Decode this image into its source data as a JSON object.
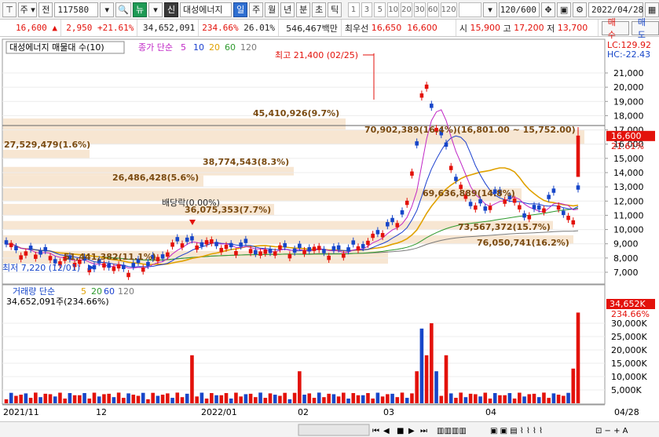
{
  "toolbar": {
    "type_select": "주",
    "prefix": "전",
    "code": "117580",
    "news_btn": "뉴",
    "sin_btn": "신",
    "stock_name": "대성에너지",
    "periods": [
      "일",
      "주",
      "월",
      "년",
      "분",
      "초",
      "틱"
    ],
    "active_period": "일",
    "minute_steps": [
      "1",
      "3",
      "5",
      "10",
      "20",
      "30",
      "60",
      "120"
    ],
    "count": "120/600",
    "date": "2022/04/28"
  },
  "quote": {
    "price": "16,600",
    "up_arrow": "▲",
    "change": "2,950",
    "change_pct": "+21.61%",
    "volume": "34,652,091",
    "volume_pct": "234.66%",
    "turnover_pct": "26.01%",
    "amount": "546,467백만",
    "best_ask_label": "최우선",
    "best_ask": "16,650",
    "best_bid": "16,600",
    "open_label": "시",
    "open": "15,900",
    "high_label": "고",
    "high": "17,200",
    "low_label": "저",
    "low": "13,700",
    "buy_btn": "매수",
    "sell_btn": "매도"
  },
  "price_panel": {
    "title": "대성에너지 매물대 수(10)",
    "ma_title": "종가 단순",
    "ma_periods": [
      "5",
      "10",
      "20",
      "60",
      "120"
    ],
    "lc": "LC:129.92",
    "hc": "HC:-22.43",
    "current_price": "16,600",
    "current_pct": "21.61%",
    "high_label": "최고 21,400 (02/25)",
    "low_label": "최저 7,220 (12/01)",
    "dividend_label": "배당락(0.00%)",
    "y_ticks": [
      "21,000",
      "20,000",
      "19,000",
      "18,000",
      "17,000",
      "16,000",
      "15,000",
      "14,000",
      "13,000",
      "12,000",
      "11,000",
      "10,000",
      "9,000",
      "8,000",
      "7,000"
    ],
    "volume_profile": [
      {
        "label": "45,410,926(9.7%)"
      },
      {
        "label": "70,902,389(16.4%)(16,801.00 ~ 15,752.00)"
      },
      {
        "label": "27,529,479(1.6%)"
      },
      {
        "label": "38,774,543(8.3%)"
      },
      {
        "label": "26,486,428(5.6%)"
      },
      {
        "label": "69,636,889(14.8%)"
      },
      {
        "label": "36,075,353(7.7%)"
      },
      {
        "label": "73,567,372(15.7%)"
      },
      {
        "label": "76,050,741(16.2%)"
      },
      {
        "label": "51,441,382(11.1%)"
      }
    ]
  },
  "volume_panel": {
    "title": "거래량 단순",
    "ma_periods": [
      "5",
      "20",
      "60",
      "120"
    ],
    "value_label": "34,652,091주(234.66%)",
    "current_value": "34,652K",
    "current_pct": "234.66%",
    "y_ticks": [
      "30,000K",
      "25,000K",
      "20,000K",
      "15,000K",
      "10,000K",
      "5,000K"
    ]
  },
  "x_axis": {
    "labels": [
      "2021/11",
      "12",
      "2022/01",
      "02",
      "03",
      "04"
    ],
    "end_label": "04/28"
  },
  "colors": {
    "up": "#e3120b",
    "down": "#1746c9",
    "ma5": "#c026c6",
    "ma10": "#1a3fcf",
    "ma20": "#e0a100",
    "ma60": "#2e9a2e",
    "ma120": "#7a7a7a",
    "profile": "#f7e6d2"
  }
}
